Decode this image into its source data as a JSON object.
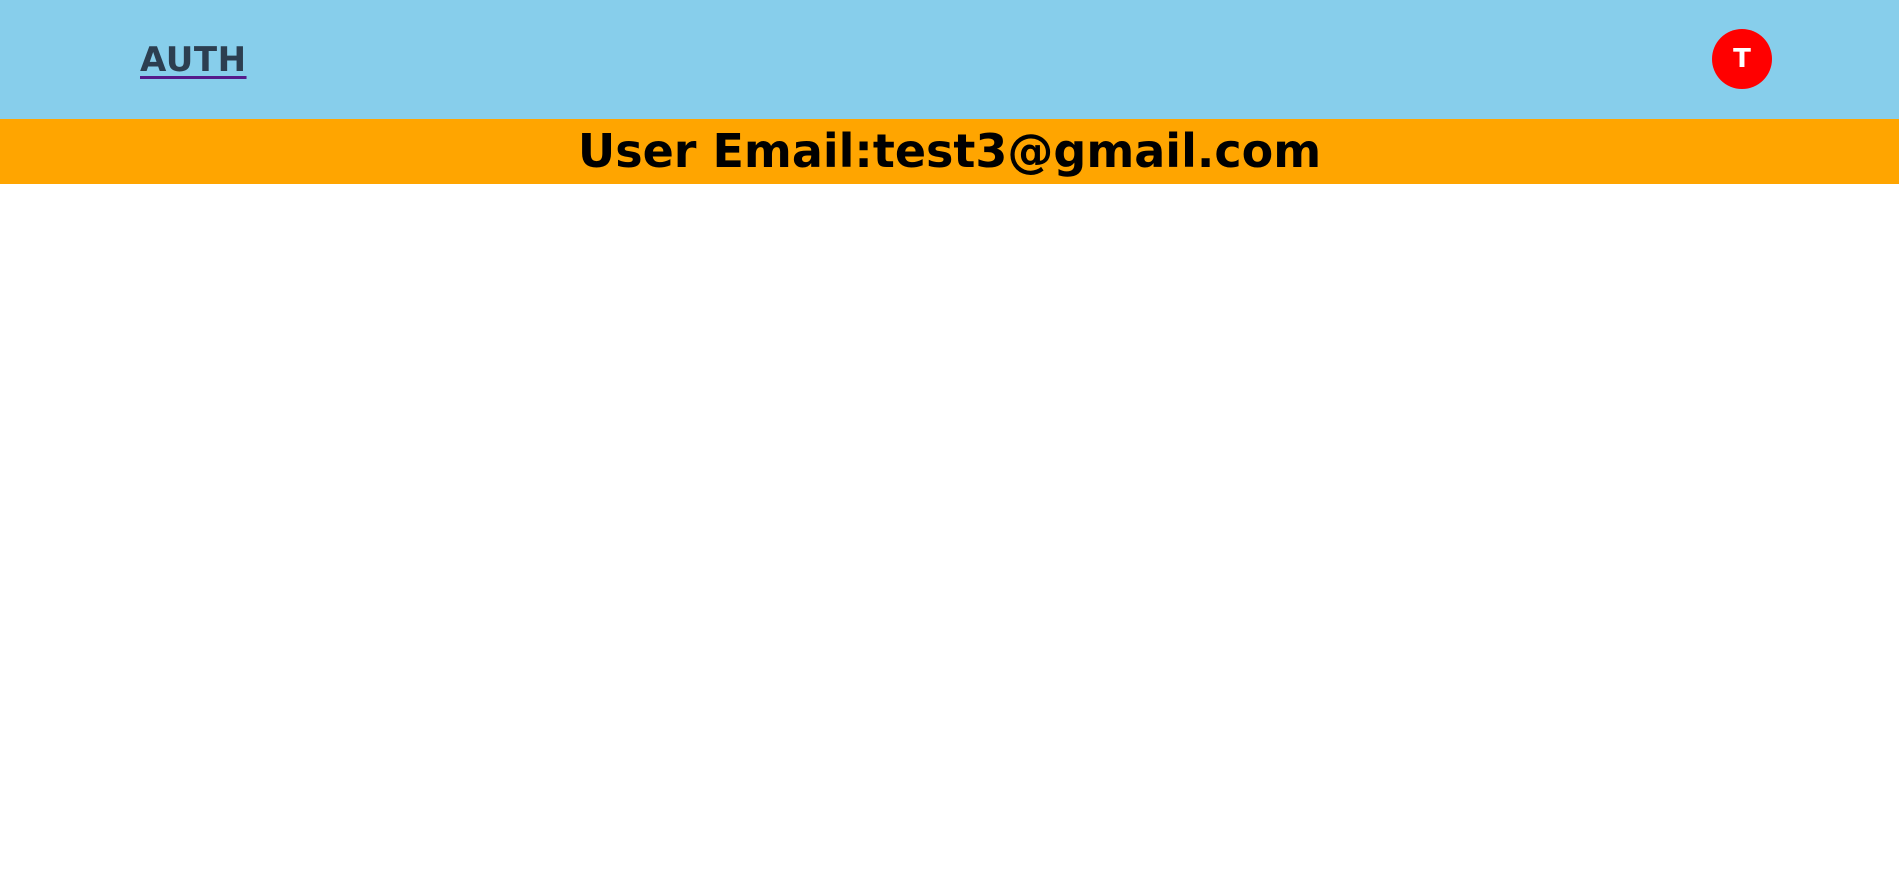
{
  "navbar": {
    "brand_label": "AUTH",
    "avatar_initial": "T",
    "background_color": "#87ceeb",
    "avatar_color": "#ff0000"
  },
  "banner": {
    "label": "User Email:",
    "email": "test3@gmail.com",
    "background_color": "#ffa500"
  }
}
